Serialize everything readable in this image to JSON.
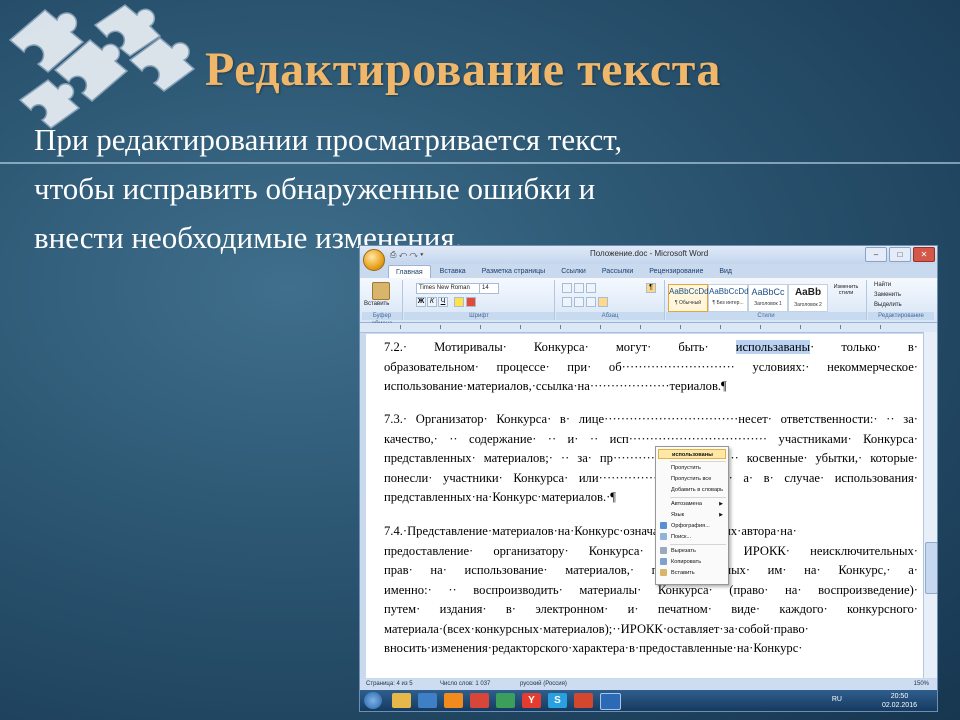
{
  "slide": {
    "title": "Редактирование текста",
    "body_lines": [
      "При редактировании просматривается текст,",
      "чтобы исправить обнаруженные ошибки и",
      "внести необходимые изменения."
    ]
  },
  "word": {
    "title": "Положение.doc - Microsoft Word",
    "qat": "⎙ ↶ ↷ ▾",
    "window_buttons": [
      "–",
      "□",
      "✕"
    ],
    "tabs": [
      "Главная",
      "Вставка",
      "Разметка страницы",
      "Ссылки",
      "Рассылки",
      "Рецензирование",
      "Вид"
    ],
    "active_tab": "Главная",
    "ribbon": {
      "paste_label": "Вставить",
      "font_name": "Times New Roman",
      "font_size": "14",
      "groups": [
        "Буфер обмена",
        "Шрифт",
        "Абзац",
        "Стили",
        "Редактирование"
      ],
      "styles": [
        {
          "sample": "AaBbCcDd",
          "name": "¶ Обычный"
        },
        {
          "sample": "AaBbCcDd",
          "name": "¶ Без интер..."
        },
        {
          "sample": "AaBbCc",
          "name": "Заголовок 1"
        },
        {
          "sample": "AaBb",
          "name": "Заголовок 2"
        }
      ],
      "change_styles": "Изменить стили",
      "editing": [
        "Найти",
        "Заменить",
        "Выделить"
      ]
    },
    "document": {
      "paragraphs": [
        [
          "7.2.· Мотиривалы· Конкурса· могут· быть· ",
          "использаваны",
          "· только· в·",
          "образовательном· процессе· при· об··························· условиях:· некоммерческое·",
          "использование·материалов,·ссылка·на···················териалов.¶"
        ],
        [
          "7.3.· Организатор· Конкурса· в· лице································несет· ответственности:· ·· за·",
          "качество,· ·· содержание· ·· и· ·· исп································· участниками· Конкурса·",
          "представленных· материалов;· ·· за· пр······························ косвенные· убытки,· которые·",
          "понесли· участники· Конкурса· или································ а· в· случае· использования·",
          "представленных·на·Конкурс·материалов.·¶"
        ],
        [
          "7.4.·Представление·материалов·на·Конкурс·означает·согласие·их·автора·на·",
          "предоставление· организатору· Конкурса· в· лице· ИРОКК· неисключительных·",
          "прав· на· использование· материалов,· предоставленных· им· на· Конкурс,· а·",
          "именно:· ·· воспроизводить· материалы· Конкурса· (право· на· воспроизведение)·",
          "путем· издания· в· электронном· и· печатном· виде· каждого· конкурсного·",
          "материала·(всех·конкурсных·материалов);··ИРОКК·оставляет·за·собой·право·",
          "вносить·изменения·редакторского·характера·в·предоставленные·на·Конкурс·"
        ]
      ]
    },
    "context_menu": {
      "items": [
        {
          "label": "использованы",
          "bold": true
        },
        {
          "label": "Пропустить"
        },
        {
          "label": "Пропустить все"
        },
        {
          "label": "Добавить в словарь"
        },
        {
          "label": "Автозамена",
          "submenu": true
        },
        {
          "label": "Язык",
          "submenu": true
        },
        {
          "label": "Орфография..."
        },
        {
          "label": "Поиск..."
        },
        {
          "label": "Вырезать"
        },
        {
          "label": "Копировать"
        },
        {
          "label": "Вставить"
        }
      ]
    },
    "status": {
      "page": "Страница: 4 из 5",
      "words": "Число слов: 1 037",
      "language": "русский (Россия)",
      "zoom": "150%"
    },
    "taskbar": {
      "lang": "RU",
      "time": "20:50",
      "date": "02.02.2016"
    }
  }
}
